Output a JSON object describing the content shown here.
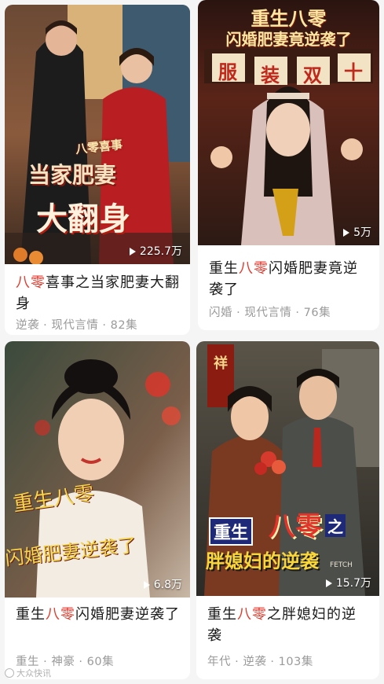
{
  "cards": [
    {
      "poster_text": [
        "八零喜事",
        "当家肥妻",
        "大翻身"
      ],
      "plays": "225.7万",
      "title": {
        "before": "",
        "highlight": "八零",
        "after": "喜事之当家肥妻大翻身"
      },
      "meta": "逆袭 · 现代言情 · 82集",
      "colors": {
        "accent": "#e33a2c"
      }
    },
    {
      "poster_text": [
        "重生八零",
        "闪婚肥妻竟逆袭了",
        "服",
        "装",
        "双",
        "十"
      ],
      "plays": "5万",
      "title": {
        "before": "重生",
        "highlight": "八零",
        "after": "闪婚肥妻竟逆袭了"
      },
      "meta": "闪婚 · 现代言情 · 76集",
      "colors": {
        "accent": "#e33a2c"
      }
    },
    {
      "poster_text": [
        "重生八零",
        "闪婚肥妻逆袭了"
      ],
      "plays": "6.8万",
      "title": {
        "before": "重生",
        "highlight": "八零",
        "after": "闪婚肥妻逆袭了"
      },
      "meta": "重生 · 神豪 · 60集",
      "colors": {
        "accent": "#e33a2c"
      }
    },
    {
      "poster_text": [
        "重生",
        "八零",
        "之",
        "胖媳妇的逆袭",
        "祥",
        "FETCH"
      ],
      "plays": "15.7万",
      "title": {
        "before": "重生",
        "highlight": "八零",
        "after": "之胖媳妇的逆袭"
      },
      "meta": "年代 · 逆袭 · 103集",
      "colors": {
        "accent": "#e33a2c"
      }
    }
  ],
  "watermark": "大众快讯",
  "icons": {
    "play": "play-triangle-icon",
    "watermark": "watermark-logo-icon"
  }
}
